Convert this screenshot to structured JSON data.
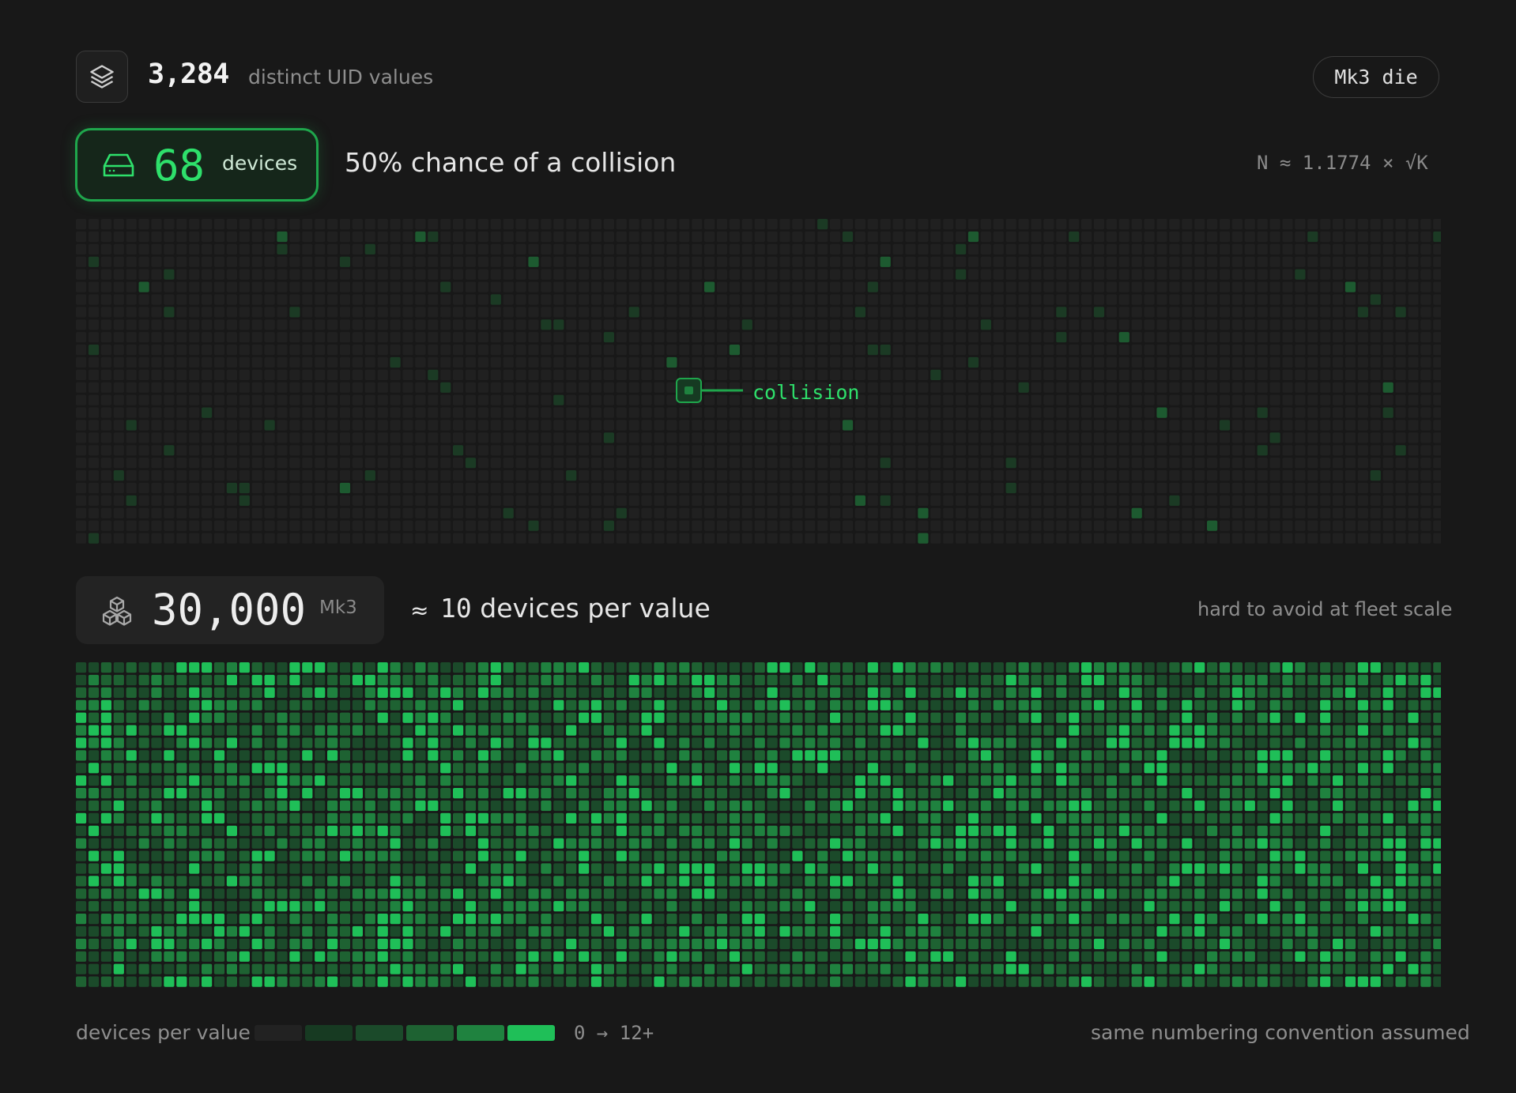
{
  "header": {
    "icon": "layers-icon",
    "uid_count": "3,284",
    "uid_label": "distinct UID values",
    "die_label": "Mk3 die"
  },
  "threshold": {
    "icon": "hard-drive-icon",
    "devices": "68",
    "devices_unit": "devices",
    "caption": "50% chance of a collision",
    "formula": "N ≈ 1.1774 × √K"
  },
  "sparse_grid": {
    "callout_label": "collision",
    "colors": {
      "empty": "#202020",
      "occupied": "#1b3a24",
      "collision": "#1d5a30"
    }
  },
  "fleet": {
    "icon": "cubes-icon",
    "count": "30,000",
    "unit": "Mk3",
    "approx_symbol": "≈",
    "per_value_number": "10",
    "per_value_text": "devices per value",
    "note": "hard to avoid at fleet scale"
  },
  "legend": {
    "label": "devices per value",
    "range": "0 → 12+",
    "colors": [
      "#222222",
      "#173a22",
      "#1b4a2a",
      "#1e6232",
      "#1f823f",
      "#1fbf58"
    ],
    "note": "same numbering convention assumed"
  },
  "accent_color": "#2ee06b"
}
